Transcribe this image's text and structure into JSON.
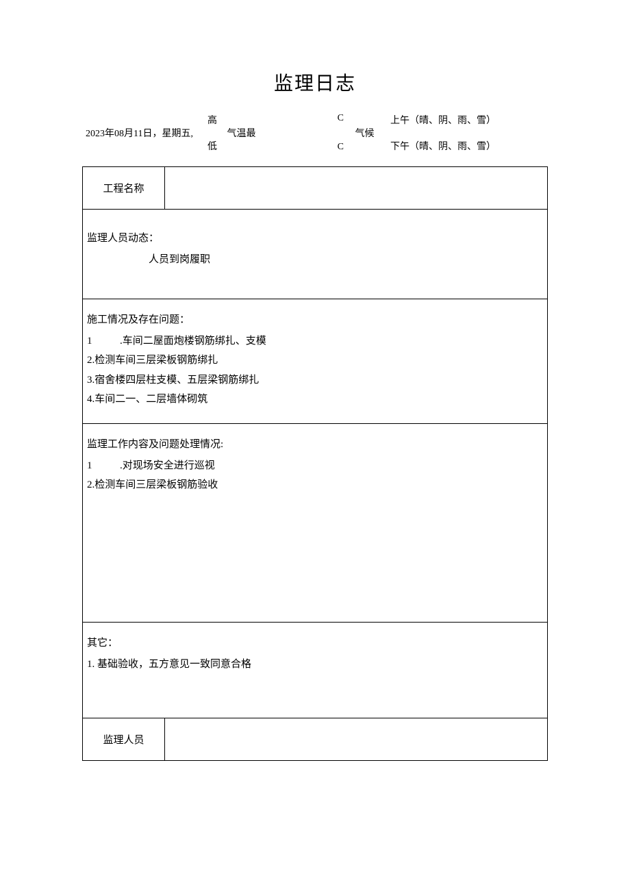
{
  "title": "监理日志",
  "header": {
    "date": "2023年08月11日，星期五,",
    "temp_label": "气温最",
    "temp_high": "高",
    "temp_low": "低",
    "temp_unit_high": "C",
    "temp_unit_low": "C",
    "climate_label": "气候",
    "climate_am": "上午（晴、阴、雨、雪）",
    "climate_pm": "下午（晴、阴、雨、雪）"
  },
  "sections": {
    "project_name_label": "工程名称",
    "project_name_value": "",
    "personnel": {
      "title": "监理人员动态：",
      "line1": "人员到岗履职"
    },
    "construction": {
      "title": "施工情况及存在问题：",
      "item1_num": "1",
      "item1_text": ".车间二屋面炮楼钢筋绑扎、支模",
      "item2": "2.检测车间三层梁板钢筋绑扎",
      "item3": "3.宿舍楼四层柱支模、五层梁钢筋绑扎",
      "item4": "4.车间二一、二层墙体砌筑"
    },
    "work": {
      "title": "监理工作内容及问题处理情况:",
      "item1_num": "1",
      "item1_text": ".对现场安全进行巡视",
      "item2": "2.检测车间三层梁板钢筋验收"
    },
    "other": {
      "title": "其它：",
      "item1": "1. 基础验收，五方意见一致同意合格"
    },
    "supervisor_label": "监理人员",
    "supervisor_value": ""
  }
}
